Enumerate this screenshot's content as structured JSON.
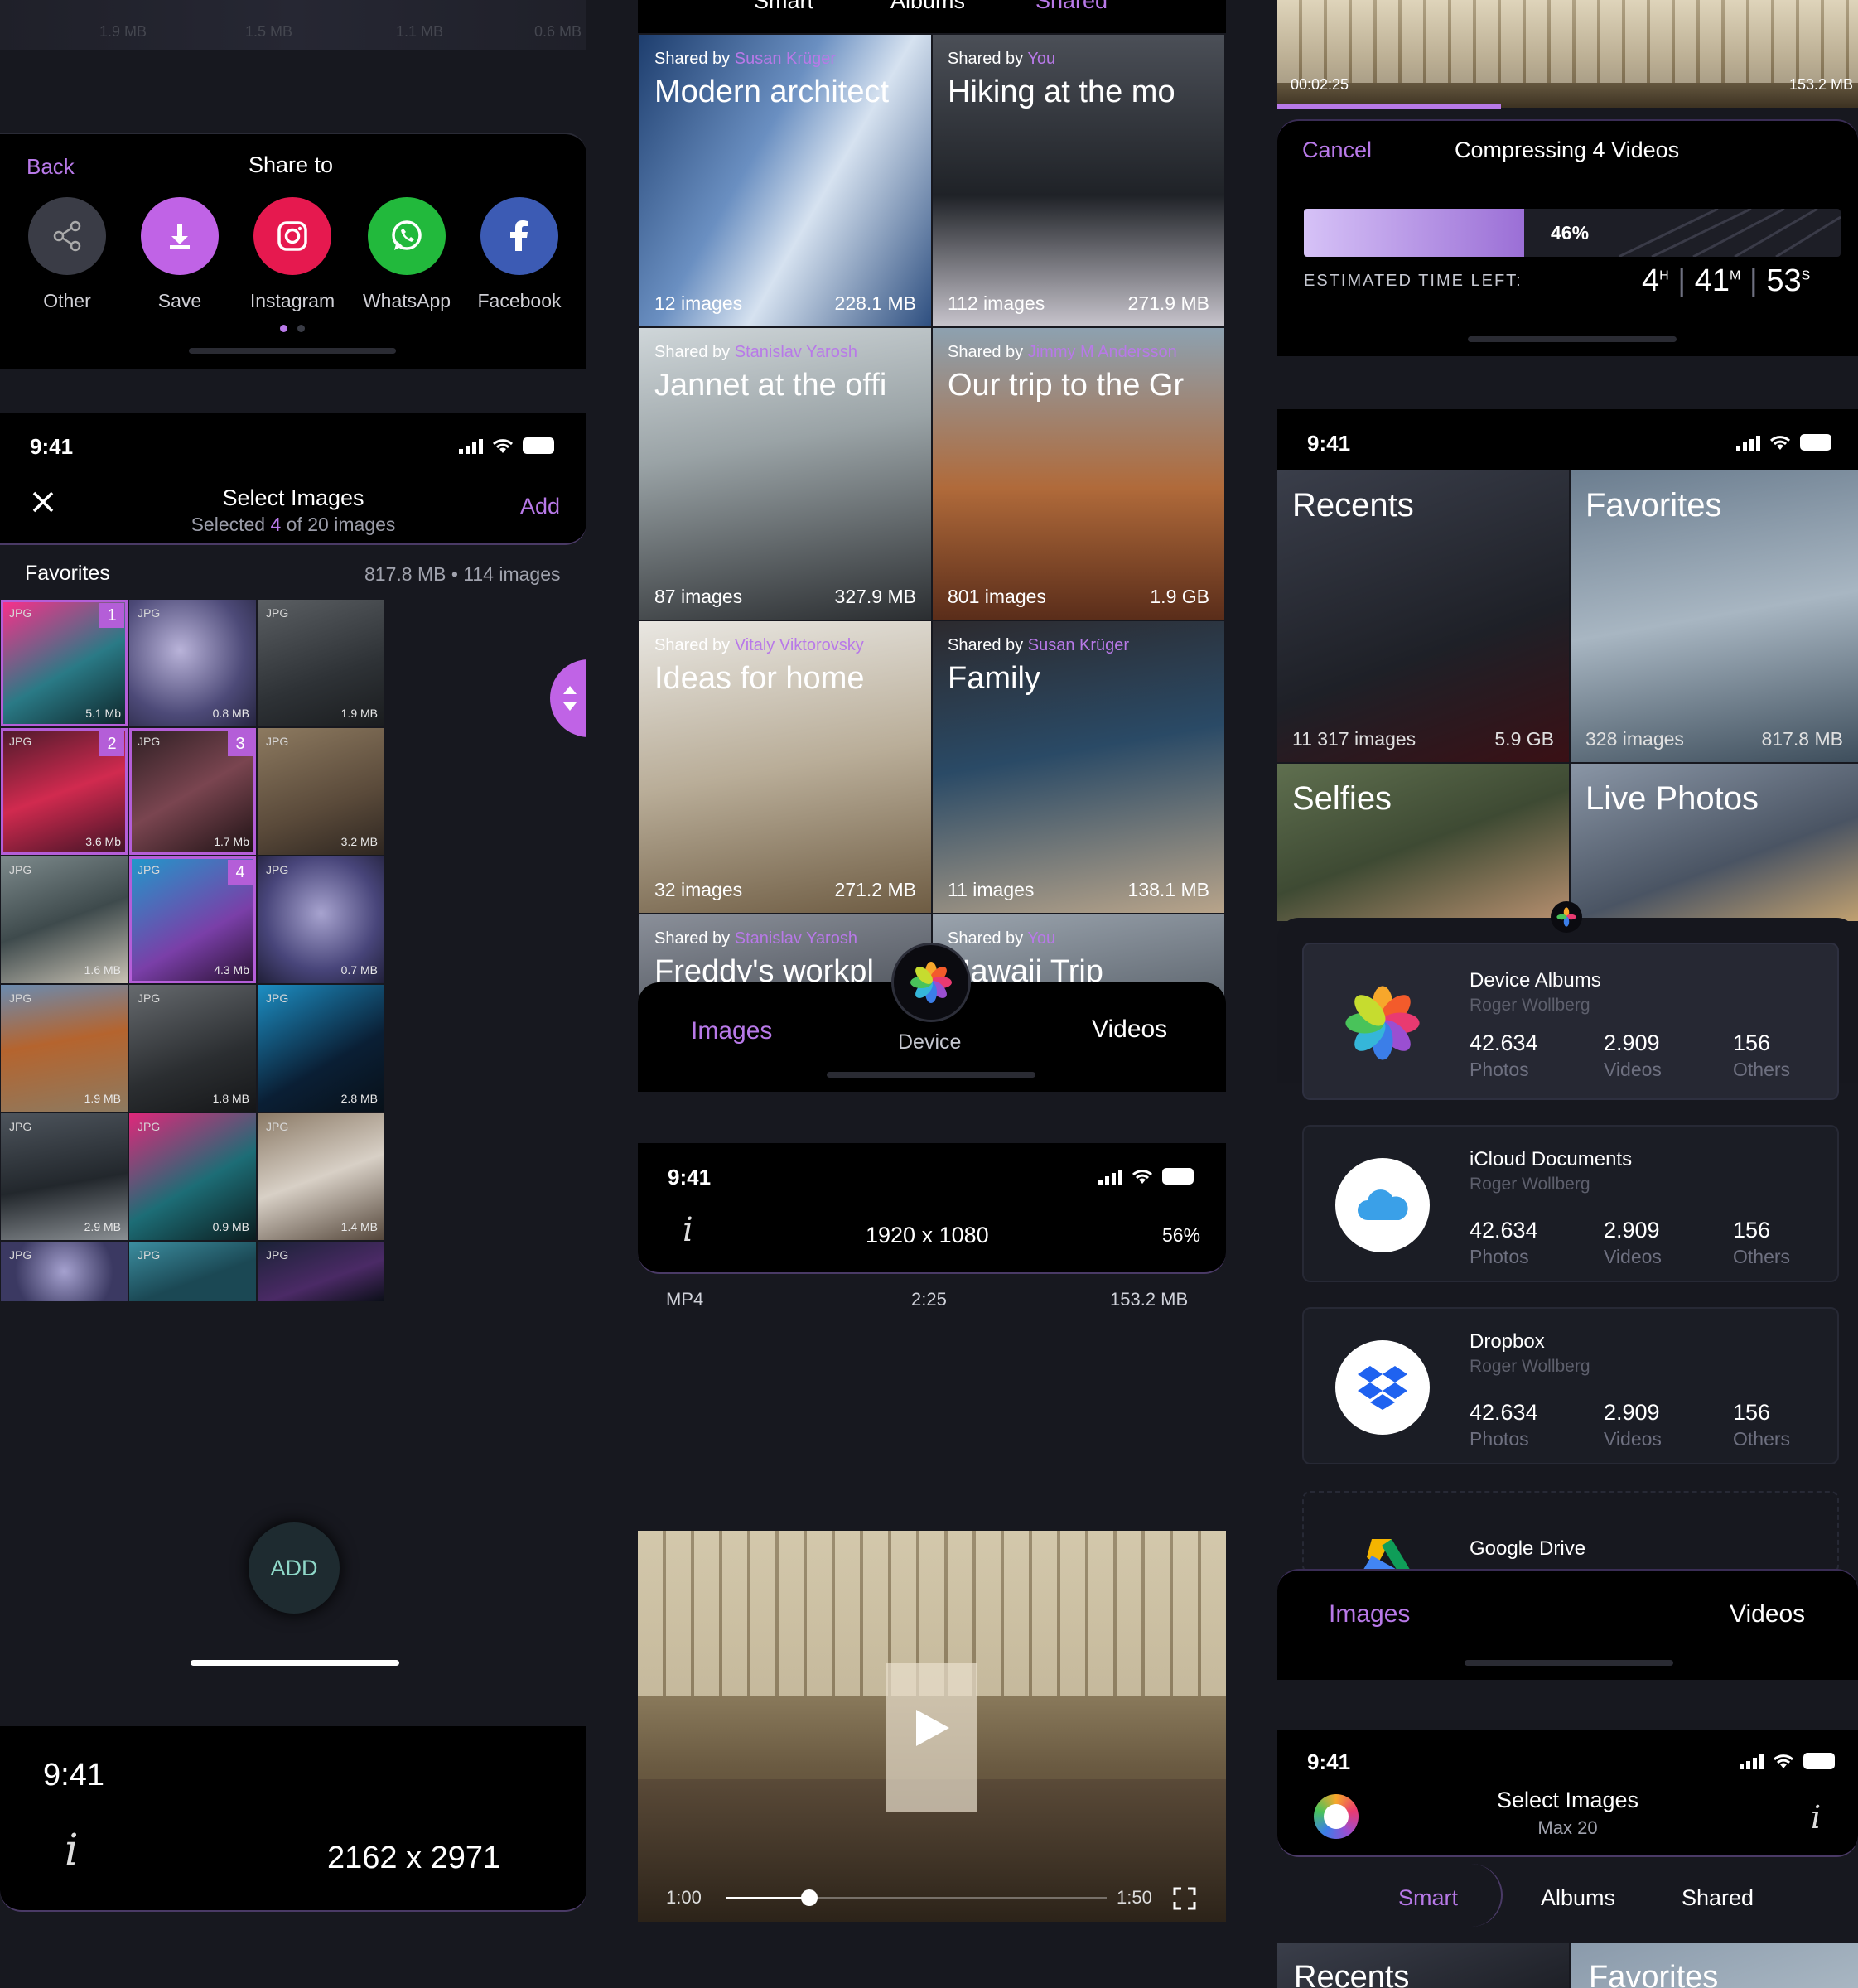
{
  "colors": {
    "accent": "#b879e8",
    "background": "#17181f",
    "panel": "#000000"
  },
  "left": {
    "top_sizes": [
      "1.9 MB",
      "1.5 MB",
      "1.1 MB",
      "0.6 MB"
    ],
    "share_sheet": {
      "back": "Back",
      "title": "Share to",
      "options": [
        {
          "label": "Other",
          "icon": "share-nodes-icon",
          "color": "#3a3c46"
        },
        {
          "label": "Save",
          "icon": "download-icon",
          "color": "#c063e6"
        },
        {
          "label": "Instagram",
          "icon": "instagram-icon",
          "color": "#e6194f"
        },
        {
          "label": "WhatsApp",
          "icon": "whatsapp-icon",
          "color": "#22b93c"
        },
        {
          "label": "Facebook",
          "icon": "facebook-icon",
          "color": "#3c5bb4"
        }
      ]
    },
    "select": {
      "time": "9:41",
      "title": "Select Images",
      "subtitle_pre": "Selected ",
      "subtitle_count": "4",
      "subtitle_post": " of 20 images",
      "add": "Add",
      "section": "Favorites",
      "section_info": "817.8 MB • 114 images",
      "add_button": "ADD",
      "photos": [
        {
          "tag": "JPG",
          "size": "5.1 Mb",
          "badge": "1"
        },
        {
          "tag": "JPG",
          "size": "0.8 MB",
          "badge": ""
        },
        {
          "tag": "JPG",
          "size": "1.9 MB",
          "badge": ""
        },
        {
          "tag": "JPG",
          "size": "3.6 Mb",
          "badge": "2"
        },
        {
          "tag": "JPG",
          "size": "1.7 Mb",
          "badge": "3"
        },
        {
          "tag": "JPG",
          "size": "3.2 MB",
          "badge": ""
        },
        {
          "tag": "JPG",
          "size": "1.6 MB",
          "badge": ""
        },
        {
          "tag": "JPG",
          "size": "4.3 Mb",
          "badge": "4"
        },
        {
          "tag": "JPG",
          "size": "0.7 MB",
          "badge": ""
        },
        {
          "tag": "JPG",
          "size": "1.9 MB",
          "badge": ""
        },
        {
          "tag": "JPG",
          "size": "1.8 MB",
          "badge": ""
        },
        {
          "tag": "JPG",
          "size": "2.8 MB",
          "badge": ""
        },
        {
          "tag": "JPG",
          "size": "2.9 MB",
          "badge": ""
        },
        {
          "tag": "JPG",
          "size": "0.9 MB",
          "badge": ""
        },
        {
          "tag": "JPG",
          "size": "1.4 MB",
          "badge": ""
        },
        {
          "tag": "JPG",
          "size": "",
          "badge": ""
        },
        {
          "tag": "JPG",
          "size": "",
          "badge": ""
        },
        {
          "tag": "JPG",
          "size": "",
          "badge": ""
        }
      ]
    },
    "viewer": {
      "time": "9:41",
      "info": "i",
      "resolution": "2162 x 2971"
    }
  },
  "middle": {
    "top_tabs": [
      "Smart",
      "Albums",
      "Shared"
    ],
    "shared": [
      {
        "by": "Shared by ",
        "who": "Susan Krüger",
        "title": "Modern architect",
        "count": "12 images",
        "size": "228.1 MB"
      },
      {
        "by": "Shared by ",
        "who": "You",
        "title": "Hiking at the mo",
        "count": "112 images",
        "size": "271.9 MB"
      },
      {
        "by": "Shared by ",
        "who": "Stanislav Yarosh",
        "title": "Jannet at the offi",
        "count": "87 images",
        "size": "327.9 MB"
      },
      {
        "by": "Shared by ",
        "who": "Jimmy M Andersson",
        "title": "Our trip to the Gr",
        "count": "801 images",
        "size": "1.9 GB"
      },
      {
        "by": "Shared by ",
        "who": "Vitaly Viktorovsky",
        "title": "Ideas for home",
        "count": "32 images",
        "size": "271.2 MB"
      },
      {
        "by": "Shared by ",
        "who": "Susan Krüger",
        "title": "Family",
        "count": "11 images",
        "size": "138.1 MB"
      },
      {
        "by": "Shared by ",
        "who": "Stanislav Yarosh",
        "title": "Freddy's workpl",
        "count": "",
        "size": ""
      },
      {
        "by": "Shared by ",
        "who": "You",
        "title": "Hawaii Trip",
        "count": "",
        "size": ""
      }
    ],
    "bottom_tabs": {
      "images": "Images",
      "device": "Device",
      "videos": "Videos"
    },
    "video": {
      "time": "9:41",
      "info": "i",
      "resolution": "1920 x 1080",
      "zoom": "56%",
      "format": "MP4",
      "duration": "2:25",
      "size": "153.2 MB",
      "current": "1:00",
      "end": "1:50",
      "progress": 0.22
    }
  },
  "right": {
    "top_time": "00:02:25",
    "top_size": "153.2 MB",
    "compress": {
      "cancel": "Cancel",
      "title": "Compressing 4 Videos",
      "percent_label": "46%",
      "percent": 0.41,
      "eta_label": "ESTIMATED TIME LEFT:",
      "h": "4",
      "h_unit": "H",
      "m": "41",
      "m_unit": "M",
      "s": "53",
      "s_unit": "S"
    },
    "albums": {
      "time": "9:41",
      "categories": [
        {
          "title": "Recents",
          "count": "11 317 images",
          "size": "5.9 GB"
        },
        {
          "title": "Favorites",
          "count": "328 images",
          "size": "817.8 MB"
        },
        {
          "title": "Selfies",
          "count": "",
          "size": ""
        },
        {
          "title": "Live Photos",
          "count": "",
          "size": ""
        }
      ],
      "sources": [
        {
          "name": "Device Albums",
          "owner": "Roger Wollberg",
          "photos": "42.634",
          "videos": "2.909",
          "others": "156",
          "icon": "photos-flower-icon"
        },
        {
          "name": "iCloud Documents",
          "owner": "Roger Wollberg",
          "photos": "42.634",
          "videos": "2.909",
          "others": "156",
          "icon": "cloud-icon"
        },
        {
          "name": "Dropbox",
          "owner": "Roger Wollberg",
          "photos": "42.634",
          "videos": "2.909",
          "others": "156",
          "icon": "dropbox-icon"
        },
        {
          "name": "Google Drive",
          "owner": "",
          "photos": "",
          "videos": "",
          "others": "",
          "icon": "google-drive-icon"
        }
      ],
      "stat_labels": {
        "photos": "Photos",
        "videos": "Videos",
        "others": "Others"
      },
      "tabs": {
        "images": "Images",
        "videos": "Videos"
      }
    },
    "select2": {
      "time": "9:41",
      "title": "Select Images",
      "subtitle": "Max 20",
      "info": "i",
      "tabs": [
        "Smart",
        "Albums",
        "Shared"
      ],
      "categories": [
        "Recents",
        "Favorites"
      ]
    }
  }
}
